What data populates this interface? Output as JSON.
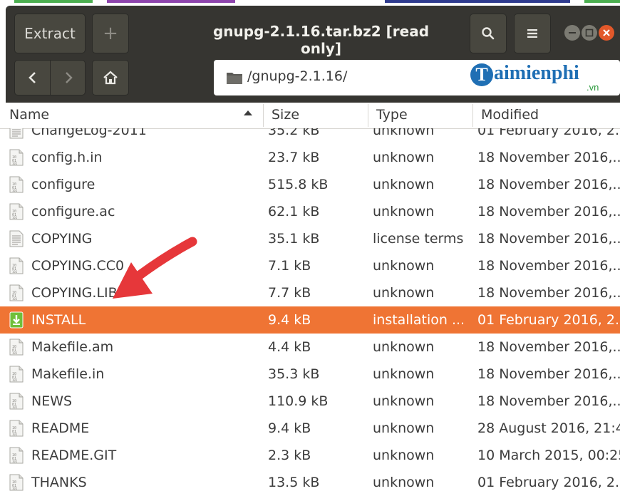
{
  "title": "gnupg-2.1.16.tar.bz2 [read only]",
  "toolbar": {
    "extract_label": "Extract",
    "add_label": "+"
  },
  "location": {
    "path": "/gnupg-2.1.16/"
  },
  "watermark": {
    "brand": "aimienphi",
    "brand_initial": "T",
    "tld": ".vn"
  },
  "columns": {
    "name": "Name",
    "size": "Size",
    "type": "Type",
    "modified": "Modified"
  },
  "files": [
    {
      "name": "ChangeLog-2011",
      "size": "35.2 kB",
      "type": "unknown",
      "modified": "01 February 2016, 2..",
      "icon": "text-file-icon"
    },
    {
      "name": "config.h.in",
      "size": "23.7 kB",
      "type": "unknown",
      "modified": "18 November 2016,..",
      "icon": "binary-file-icon"
    },
    {
      "name": "configure",
      "size": "515.8 kB",
      "type": "unknown",
      "modified": "18 November 2016,..",
      "icon": "binary-file-icon"
    },
    {
      "name": "configure.ac",
      "size": "62.1 kB",
      "type": "unknown",
      "modified": "18 November 2016,..",
      "icon": "binary-file-icon"
    },
    {
      "name": "COPYING",
      "size": "35.1 kB",
      "type": "license terms",
      "modified": "18 November 2016,..",
      "icon": "text-file-icon"
    },
    {
      "name": "COPYING.CC0",
      "size": "7.1 kB",
      "type": "unknown",
      "modified": "18 November 2016,..",
      "icon": "binary-file-icon"
    },
    {
      "name": "COPYING.LIB",
      "size": "7.7 kB",
      "type": "unknown",
      "modified": "18 November 2016,..",
      "icon": "binary-file-icon"
    },
    {
      "name": "INSTALL",
      "size": "9.4 kB",
      "type": "installation ...",
      "modified": "01 February 2016, 2..",
      "icon": "install-file-icon"
    },
    {
      "name": "Makefile.am",
      "size": "4.4 kB",
      "type": "unknown",
      "modified": "18 November 2016,..",
      "icon": "binary-file-icon"
    },
    {
      "name": "Makefile.in",
      "size": "35.3 kB",
      "type": "unknown",
      "modified": "18 November 2016,..",
      "icon": "binary-file-icon"
    },
    {
      "name": "NEWS",
      "size": "110.9 kB",
      "type": "unknown",
      "modified": "18 November 2016,..",
      "icon": "binary-file-icon"
    },
    {
      "name": "README",
      "size": "9.4 kB",
      "type": "unknown",
      "modified": "28 August 2016, 21:4",
      "icon": "binary-file-icon"
    },
    {
      "name": "README.GIT",
      "size": "2.3 kB",
      "type": "unknown",
      "modified": "10 March 2015, 00:25",
      "icon": "binary-file-icon"
    },
    {
      "name": "THANKS",
      "size": "13.5 kB",
      "type": "unknown",
      "modified": "01 February 2016, 2..",
      "icon": "binary-file-icon"
    }
  ],
  "selected_index": 7,
  "colors": {
    "headerbar": "#363531",
    "selection": "#ef7434",
    "close_button": "#e2582a",
    "annotation_arrow": "#e6373a",
    "brand": "#1f6fb4"
  }
}
